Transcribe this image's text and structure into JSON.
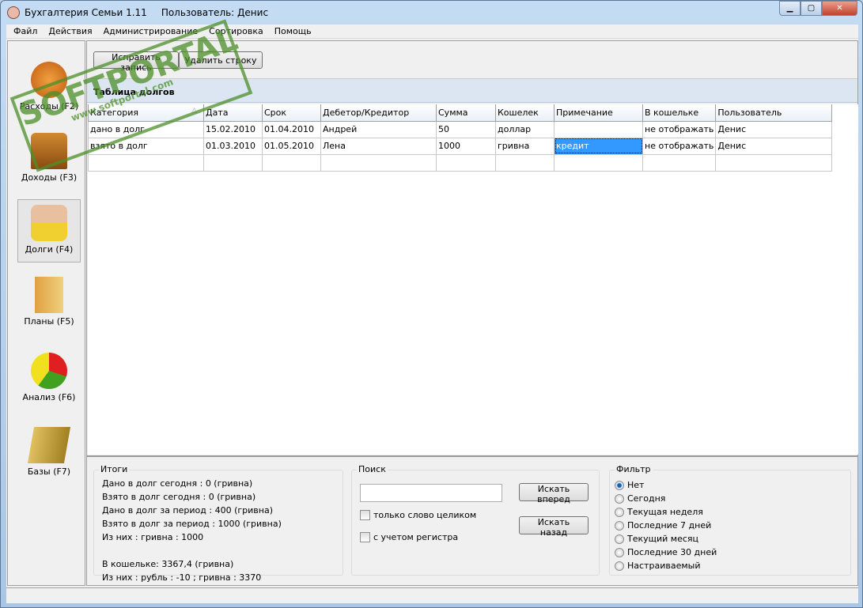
{
  "window": {
    "title": "Бухгалтерия Семьи 1.11",
    "user": "Пользователь: Денис",
    "buttons": {
      "minimize": "▁",
      "maximize": "▢",
      "close": "✕"
    }
  },
  "menu": [
    "Файл",
    "Действия",
    "Администрирование",
    "Сортировка",
    "Помощь"
  ],
  "sidebar": [
    {
      "label": "Расходы (F2)",
      "icon": "money-bag-icon"
    },
    {
      "label": "Доходы (F3)",
      "icon": "treasure-chest-icon"
    },
    {
      "label": "Долги (F4)",
      "icon": "handshake-coins-icon",
      "selected": true
    },
    {
      "label": "Планы (F5)",
      "icon": "folder-icon"
    },
    {
      "label": "Анализ (F6)",
      "icon": "pie-chart-icon"
    },
    {
      "label": "Базы (F7)",
      "icon": "books-icon"
    }
  ],
  "toolbar": {
    "edit": "Исправить запись",
    "delete": "Удалить строку"
  },
  "section_title": "Таблица долгов",
  "table": {
    "columns": [
      "Категория",
      "Дата",
      "Срок",
      "Дебетор/Кредитор",
      "Сумма",
      "Кошелек",
      "Примечание",
      "В кошельке",
      "Пользователь"
    ],
    "sort_indicator": "△",
    "rows": [
      [
        "дано в долг",
        "15.02.2010",
        "01.04.2010",
        "Андрей",
        "50",
        "доллар",
        "",
        "не отображать",
        "Денис"
      ],
      [
        "взято в долг",
        "01.03.2010",
        "01.05.2010",
        "Лена",
        "1000",
        "гривна",
        "кредит",
        "не отображать",
        "Денис"
      ]
    ]
  },
  "totals": {
    "title": "Итоги",
    "lines": [
      "Дано в долг сегодня : 0 (гривна)",
      "Взято в долг сегодня : 0 (гривна)",
      "Дано в долг за период : 400 (гривна)",
      "Взято в долг за период : 1000 (гривна)",
      "Из них : гривна : 1000",
      "",
      "В кошельке: 3367,4 (гривна)",
      "Из них : рубль : -10 ; гривна : 3370"
    ]
  },
  "search": {
    "title": "Поиск",
    "value": "",
    "forward": "Искать вперед",
    "back": "Искать назад",
    "whole_word": "только слово целиком",
    "match_case": "с учетом регистра"
  },
  "filter": {
    "title": "Фильтр",
    "options": [
      "Нет",
      "Сегодня",
      "Текущая неделя",
      "Последние 7 дней",
      "Текущий месяц",
      "Последние 30 дней",
      "Настраиваемый"
    ],
    "selected": "Нет"
  },
  "watermark": {
    "text": "SOFTPORTAL",
    "url": "www.softportal.com"
  }
}
